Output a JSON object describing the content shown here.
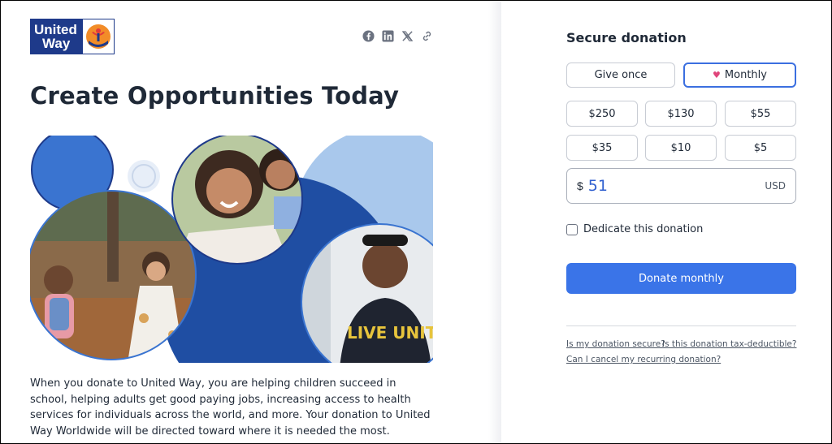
{
  "brand": {
    "logo_line1": "United",
    "logo_line2": "Way"
  },
  "share": {
    "icons": [
      "facebook-icon",
      "linkedin-icon",
      "x-icon",
      "link-icon"
    ]
  },
  "campaign": {
    "title": "Create Opportunities Today",
    "hero_shirt_text": "LIVE UNITED",
    "description": "When you donate to United Way, you are helping children succeed in school, helping adults get good paying jobs, increasing access to health services for individuals across the world, and more. Your donation to United Way Worldwide will be directed toward where it is needed the most."
  },
  "donation": {
    "heading": "Secure donation",
    "frequency": {
      "once_label": "Give once",
      "monthly_label": "Monthly",
      "selected": "Monthly"
    },
    "amounts": [
      "$250",
      "$130",
      "$55",
      "$35",
      "$10",
      "$5"
    ],
    "custom": {
      "currency_symbol": "$",
      "value": "51",
      "currency_code": "USD"
    },
    "dedicate_label": "Dedicate this donation",
    "dedicate_checked": false,
    "donate_button": "Donate monthly",
    "faq": {
      "secure": "Is my donation secure?",
      "tax": "Is this donation tax-deductible?",
      "cancel": "Can I cancel my recurring donation?"
    }
  },
  "colors": {
    "brand_navy": "#1e3a8a",
    "accent_blue": "#3a74e8",
    "heart_pink": "#e0457b"
  }
}
